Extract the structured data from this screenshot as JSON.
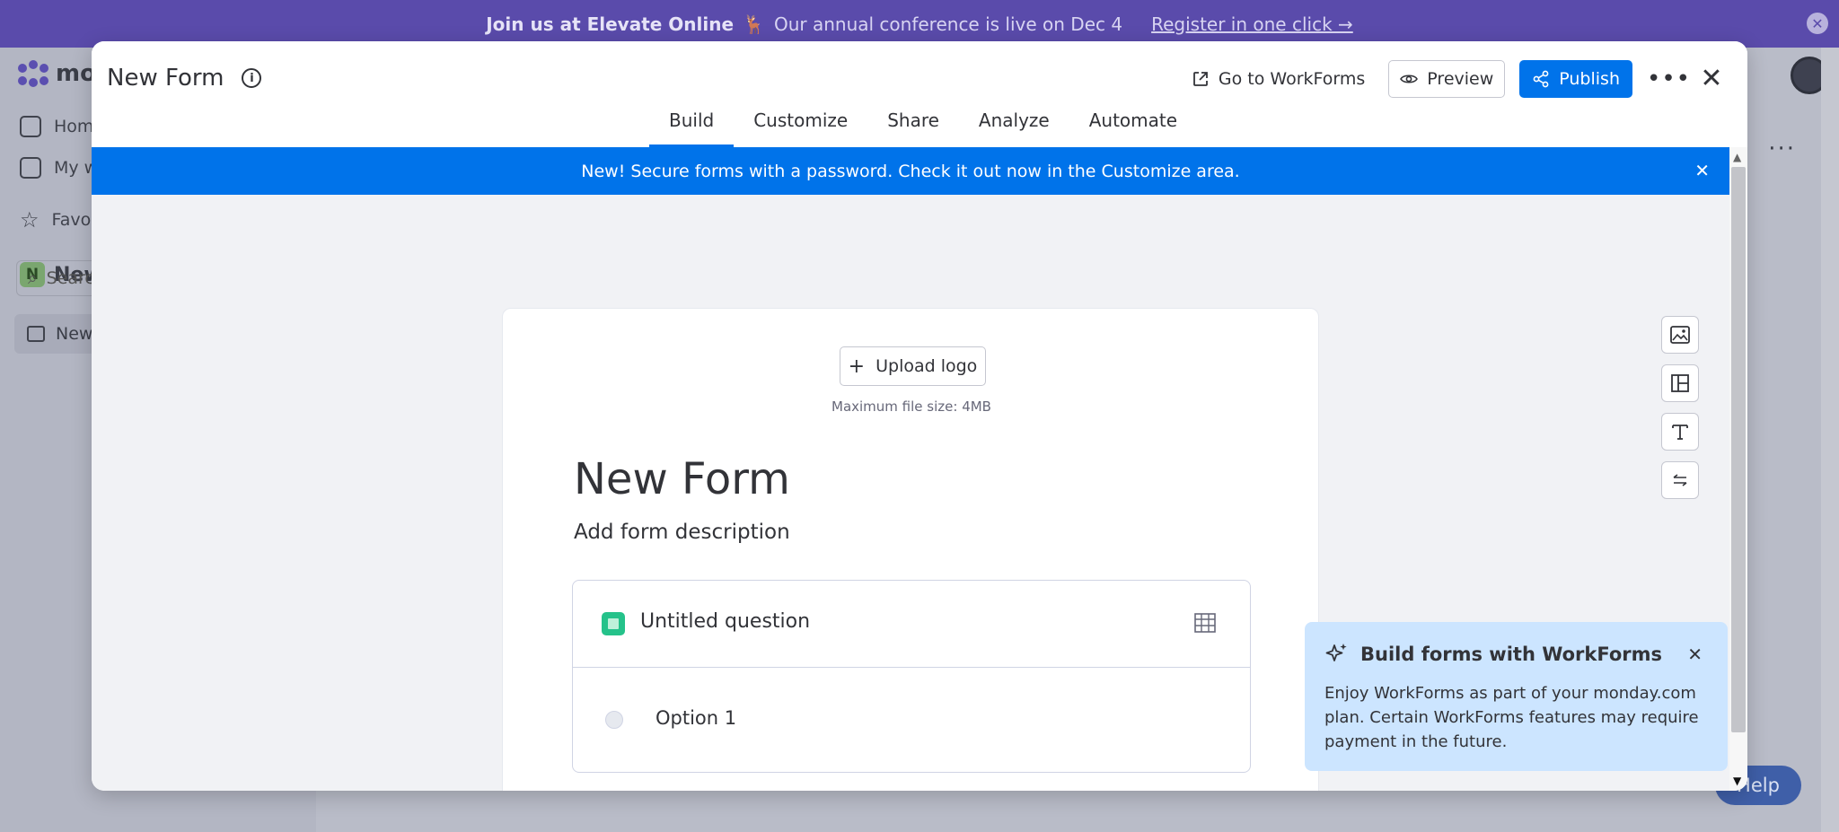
{
  "announcement": {
    "bold": "Join us at Elevate Online",
    "emoji": "🦌",
    "text": "Our annual conference is live on Dec 4",
    "link": "Register in one click →"
  },
  "background_app": {
    "logo_text": "mo",
    "sidebar": {
      "home": "Home",
      "my_work": "My w",
      "favorites": "Favori",
      "workspace_initial": "N",
      "workspace_name": "New",
      "search_placeholder": "Search",
      "board": "New"
    },
    "help": "Help"
  },
  "modal": {
    "title": "New Form",
    "actions": {
      "goto": "Go to WorkForms",
      "preview": "Preview",
      "publish": "Publish"
    },
    "tabs": [
      {
        "label": "Build",
        "active": true
      },
      {
        "label": "Customize",
        "active": false
      },
      {
        "label": "Share",
        "active": false
      },
      {
        "label": "Analyze",
        "active": false
      },
      {
        "label": "Automate",
        "active": false
      }
    ],
    "banner": "New! Secure forms with a password. Check it out now in the Customize area.",
    "form": {
      "upload_label": "Upload logo",
      "max_size": "Maximum file size: 4MB",
      "title": "New Form",
      "description": "Add form description",
      "question_title": "Untitled question",
      "option_1": "Option 1"
    },
    "promo": {
      "title": "Build forms with WorkForms",
      "body": "Enjoy WorkForms as part of your monday.com plan. Certain WorkForms features may require payment in the future."
    }
  },
  "colors": {
    "primary": "#0073ea",
    "announce_bg": "#5a4bab",
    "promo_bg": "#cce5ff",
    "question_icon": "#25c28a"
  }
}
